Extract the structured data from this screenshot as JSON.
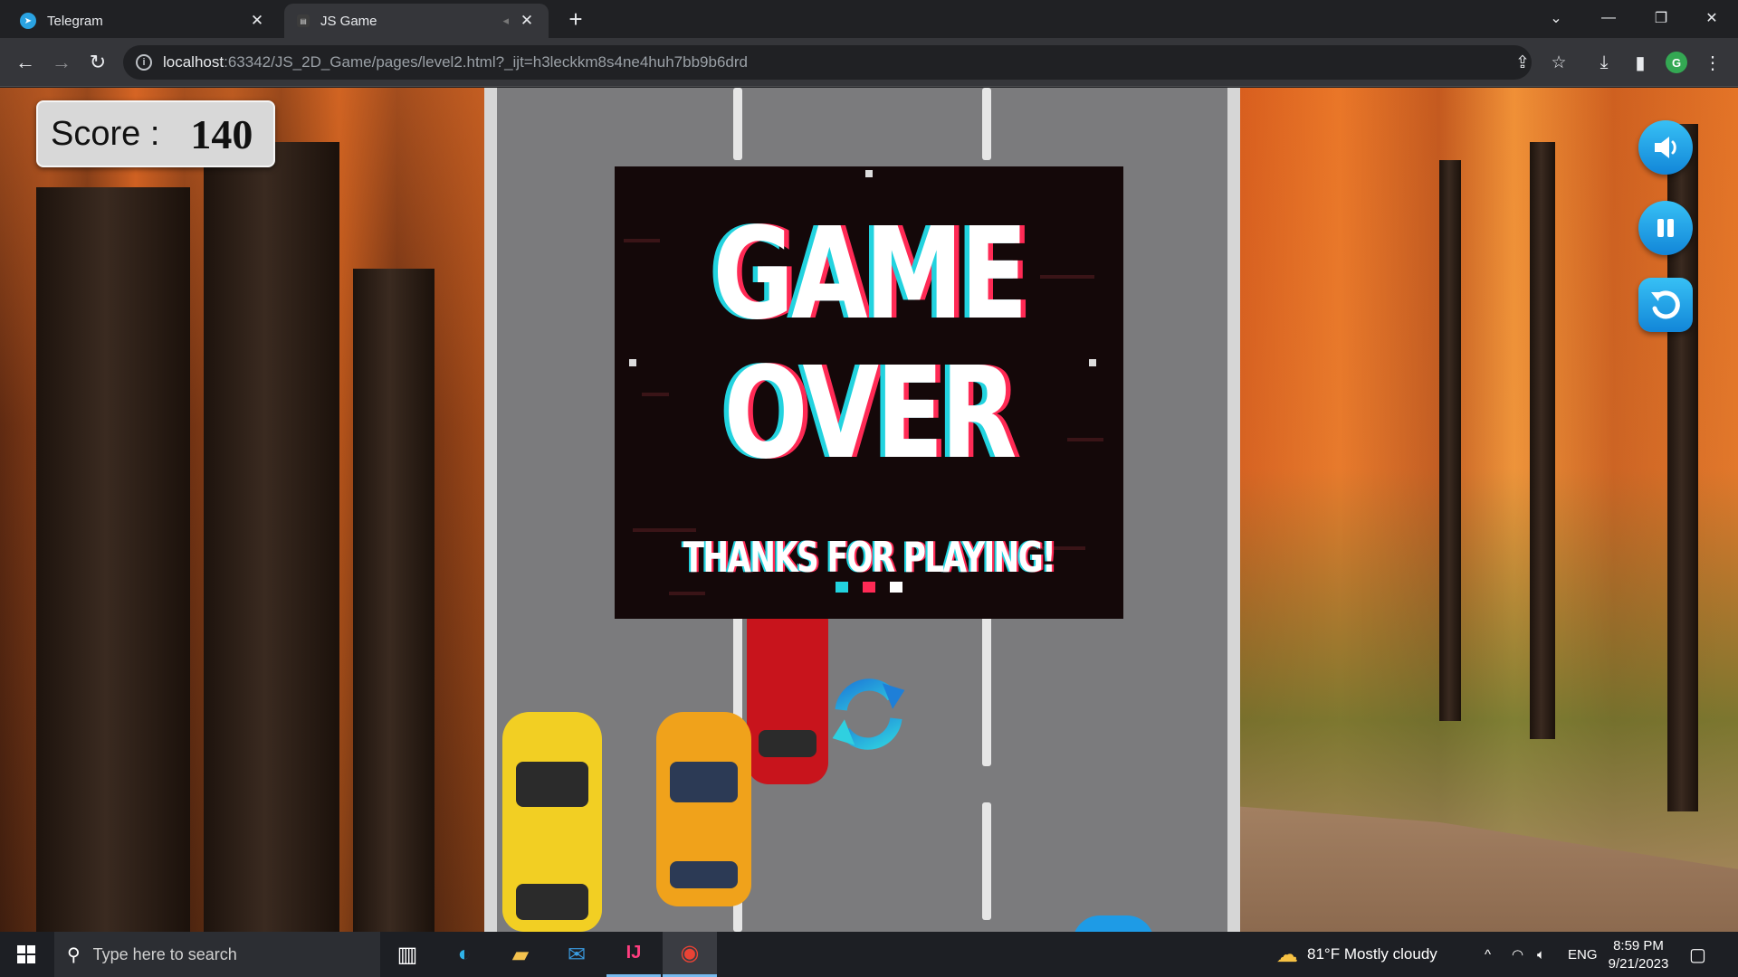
{
  "browser": {
    "tabs": [
      {
        "title": "Telegram",
        "active": false
      },
      {
        "title": "JS Game",
        "active": true
      }
    ],
    "url_host": "localhost",
    "url_rest": ":63342/JS_2D_Game/pages/level2.html?_ijt=h3leckkm8s4ne4huh7bb9b6drd",
    "profile_initial": "G"
  },
  "game": {
    "score_label": "Score :",
    "score_value": "140",
    "game_over_line1": "GAME",
    "game_over_line2": "OVER",
    "thanks_text": "THANKS FOR PLAYING!",
    "colors": {
      "glitch_cyan": "#22d3df",
      "glitch_red": "#ff2a55",
      "hud_blue": "#1e9be6"
    }
  },
  "taskbar": {
    "search_placeholder": "Type here to search",
    "weather": "81°F  Mostly cloudy",
    "language": "ENG",
    "time": "8:59 PM",
    "date": "9/21/2023"
  }
}
